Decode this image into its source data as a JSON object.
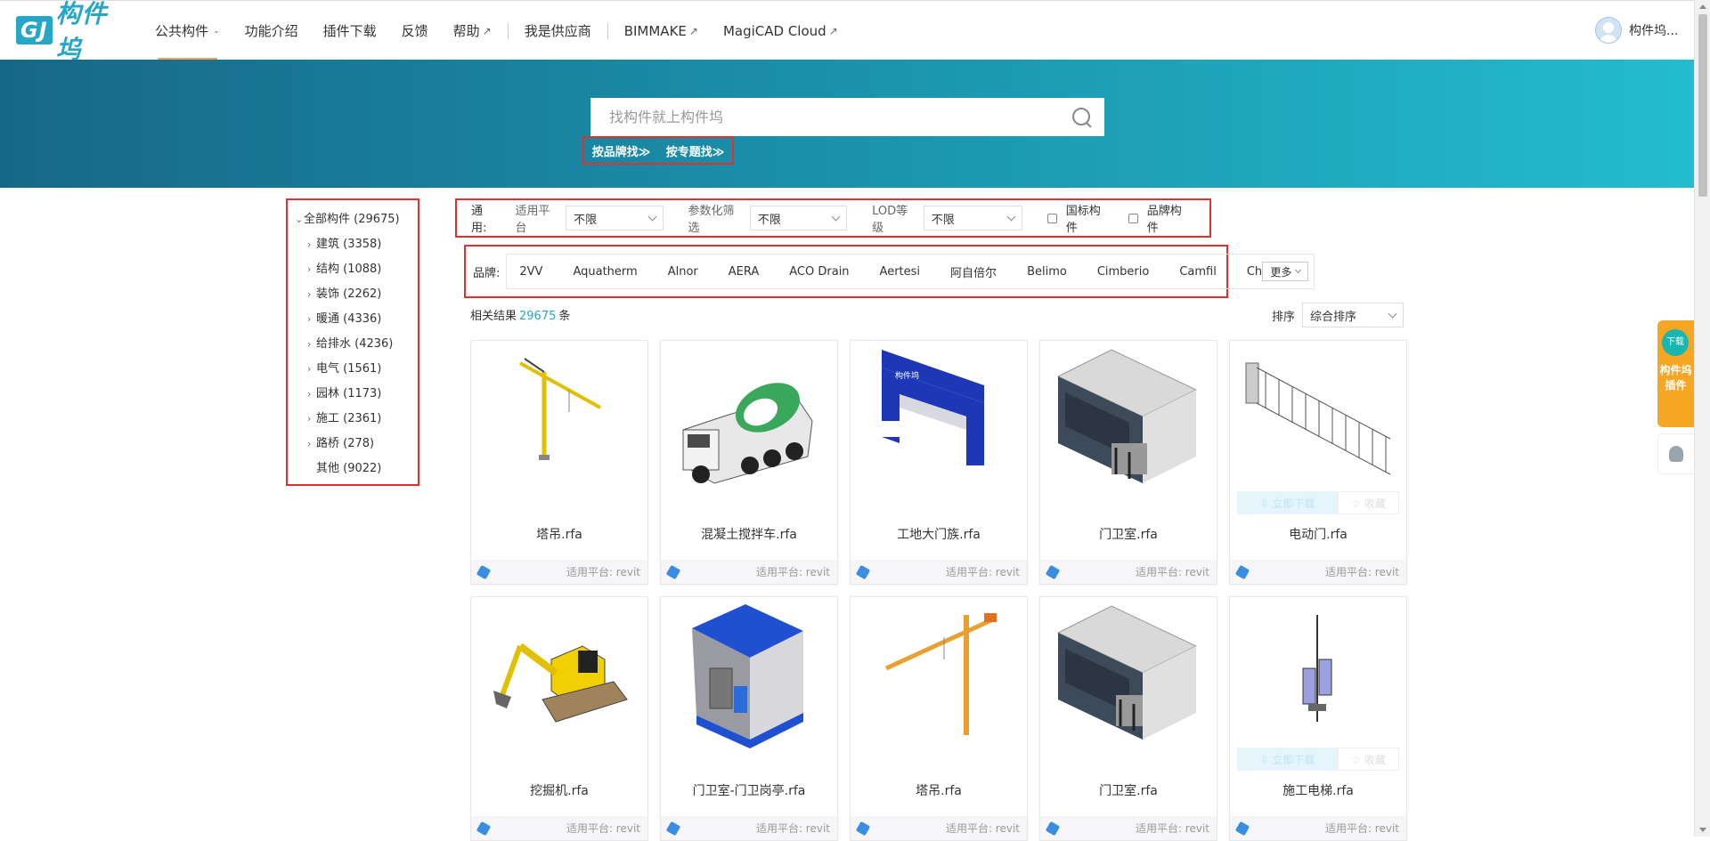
{
  "brand": {
    "logo_mark": "GJ",
    "logo_text": "构件坞"
  },
  "nav": {
    "items": [
      "公共构件",
      "功能介绍",
      "插件下载",
      "反馈",
      "帮助",
      "我是供应商",
      "BIMMAKE",
      "MagiCAD Cloud"
    ],
    "ext_arrow": "↗",
    "caret": "⌄"
  },
  "user": {
    "name": "构件坞..."
  },
  "search": {
    "placeholder": "找构件就上构件坞",
    "value": ""
  },
  "hero_links": [
    "按品牌找≫",
    "按专题找≫"
  ],
  "tree": {
    "root": "全部构件 (29675)",
    "children": [
      "建筑 (3358)",
      "结构 (1088)",
      "装饰 (2262)",
      "暖通 (4336)",
      "给排水 (4236)",
      "电气 (1561)",
      "园林 (1173)",
      "施工 (2361)",
      "路桥 (278)",
      "其他 (9022)"
    ]
  },
  "filters": {
    "general": "通用:",
    "platform_label": "适用平台",
    "platform_value": "不限",
    "param_label": "参数化筛选",
    "param_value": "不限",
    "lod_label": "LOD等级",
    "lod_value": "不限",
    "check1": "国标构件",
    "check2": "品牌构件"
  },
  "brands": {
    "label": "品牌:",
    "items": [
      "2VV",
      "Aquatherm",
      "Alnor",
      "AERA",
      "ACO Drain",
      "Aertesi",
      "阿自倍尔",
      "Belimo",
      "Cimberio",
      "Camfil",
      "Chiller"
    ],
    "more": "更多"
  },
  "results": {
    "prefix": "相关结果",
    "count": "29675",
    "suffix": "条"
  },
  "sort": {
    "label": "排序",
    "value": "综合排序"
  },
  "cards": [
    {
      "name": "塔吊.rfa",
      "platform": "适用平台:  revit",
      "icon": "tower-crane"
    },
    {
      "name": "混凝土搅拌车.rfa",
      "platform": "适用平台:  revit",
      "icon": "mixer-truck"
    },
    {
      "name": "工地大门族.rfa",
      "platform": "适用平台:  revit",
      "icon": "site-gate"
    },
    {
      "name": "门卫室.rfa",
      "platform": "适用平台:  revit",
      "icon": "guard-room"
    },
    {
      "name": "电动门.rfa",
      "platform": "适用平台:  revit",
      "icon": "electric-gate"
    },
    {
      "name": "挖掘机.rfa",
      "platform": "适用平台:  revit",
      "icon": "excavator"
    },
    {
      "name": "门卫室-门卫岗亭.rfa",
      "platform": "适用平台:  revit",
      "icon": "guard-booth"
    },
    {
      "name": "塔吊.rfa",
      "platform": "适用平台:  revit",
      "icon": "tower-crane"
    },
    {
      "name": "门卫室.rfa",
      "platform": "适用平台:  revit",
      "icon": "guard-room"
    },
    {
      "name": "施工电梯.rfa",
      "platform": "适用平台:  revit",
      "icon": "construction-elevator"
    }
  ],
  "card_actions": {
    "download": "⇩ 立即下载",
    "favorite": "☆ 收藏"
  },
  "float": {
    "download_badge": "下载",
    "plugin_label": "构件坞插件"
  }
}
